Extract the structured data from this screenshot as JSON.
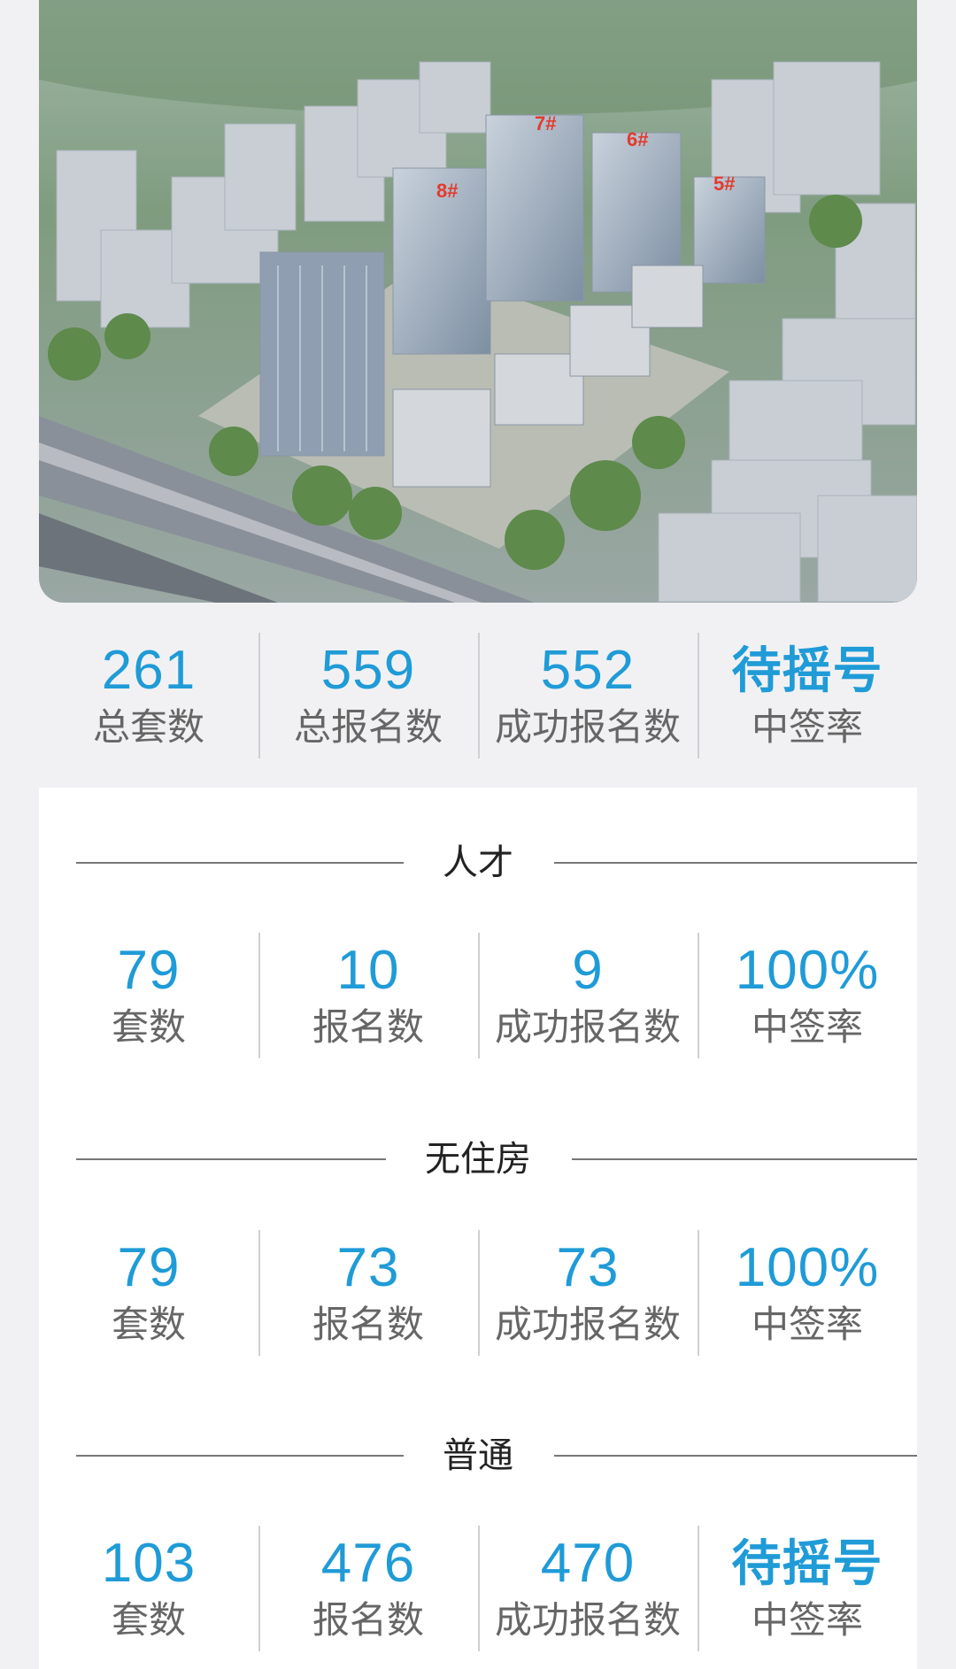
{
  "hero": {
    "building_tags": [
      "7#",
      "6#",
      "8#",
      "5#"
    ]
  },
  "summary": [
    {
      "value": "261",
      "label": "总套数"
    },
    {
      "value": "559",
      "label": "总报名数"
    },
    {
      "value": "552",
      "label": "成功报名数"
    },
    {
      "value": "待摇号",
      "label": "中签率"
    }
  ],
  "sections": [
    {
      "title": "人才",
      "stats": [
        {
          "value": "79",
          "label": "套数"
        },
        {
          "value": "10",
          "label": "报名数"
        },
        {
          "value": "9",
          "label": "成功报名数"
        },
        {
          "value": "100%",
          "label": "中签率"
        }
      ]
    },
    {
      "title": "无住房",
      "stats": [
        {
          "value": "79",
          "label": "套数"
        },
        {
          "value": "73",
          "label": "报名数"
        },
        {
          "value": "73",
          "label": "成功报名数"
        },
        {
          "value": "100%",
          "label": "中签率"
        }
      ]
    },
    {
      "title": "普通",
      "stats": [
        {
          "value": "103",
          "label": "套数"
        },
        {
          "value": "476",
          "label": "报名数"
        },
        {
          "value": "470",
          "label": "成功报名数"
        },
        {
          "value": "待摇号",
          "label": "中签率"
        }
      ]
    }
  ],
  "colors": {
    "accent": "#1f9bd7",
    "label": "#666666",
    "tag": "#e23b2e"
  }
}
